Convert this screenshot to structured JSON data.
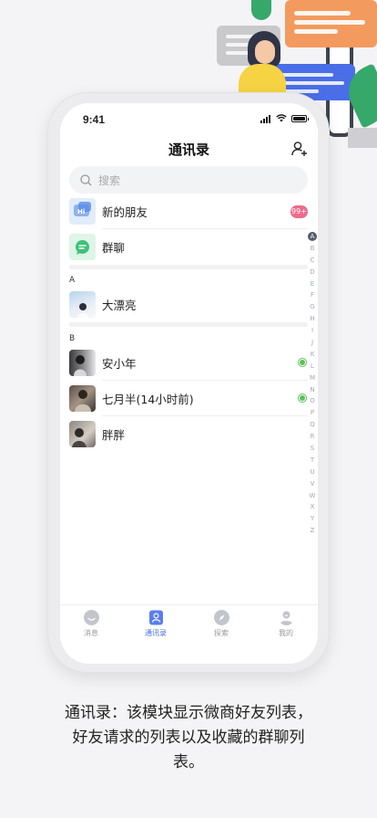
{
  "status_bar": {
    "time": "9:41"
  },
  "nav": {
    "title": "通讯录"
  },
  "search": {
    "placeholder": "搜索"
  },
  "top_items": [
    {
      "label": "新的朋友",
      "badge": "99+"
    },
    {
      "label": "群聊"
    }
  ],
  "sections": [
    {
      "letter": "A",
      "contacts": [
        {
          "name": "大漂亮"
        }
      ]
    },
    {
      "letter": "B",
      "contacts": [
        {
          "name": "安小年",
          "online": true
        },
        {
          "name": "七月半(14小时前)",
          "online": true
        },
        {
          "name": "胖胖"
        }
      ]
    }
  ],
  "index_letters": [
    "A",
    "B",
    "C",
    "D",
    "E",
    "F",
    "G",
    "H",
    "I",
    "J",
    "K",
    "L",
    "M",
    "N",
    "O",
    "P",
    "Q",
    "R",
    "S",
    "T",
    "U",
    "V",
    "W",
    "X",
    "Y",
    "Z"
  ],
  "tabs": [
    {
      "label": "消息",
      "icon": "message-icon"
    },
    {
      "label": "通讯录",
      "icon": "contacts-icon",
      "active": true
    },
    {
      "label": "探索",
      "icon": "compass-icon"
    },
    {
      "label": "我的",
      "icon": "profile-icon"
    }
  ],
  "caption": "通讯录：该模块显示微商好友列表，好友请求的列表以及收藏的群聊列表。",
  "colors": {
    "accent": "#4a6ee8",
    "badge": "#f06a8a",
    "online": "#5ac25a"
  }
}
